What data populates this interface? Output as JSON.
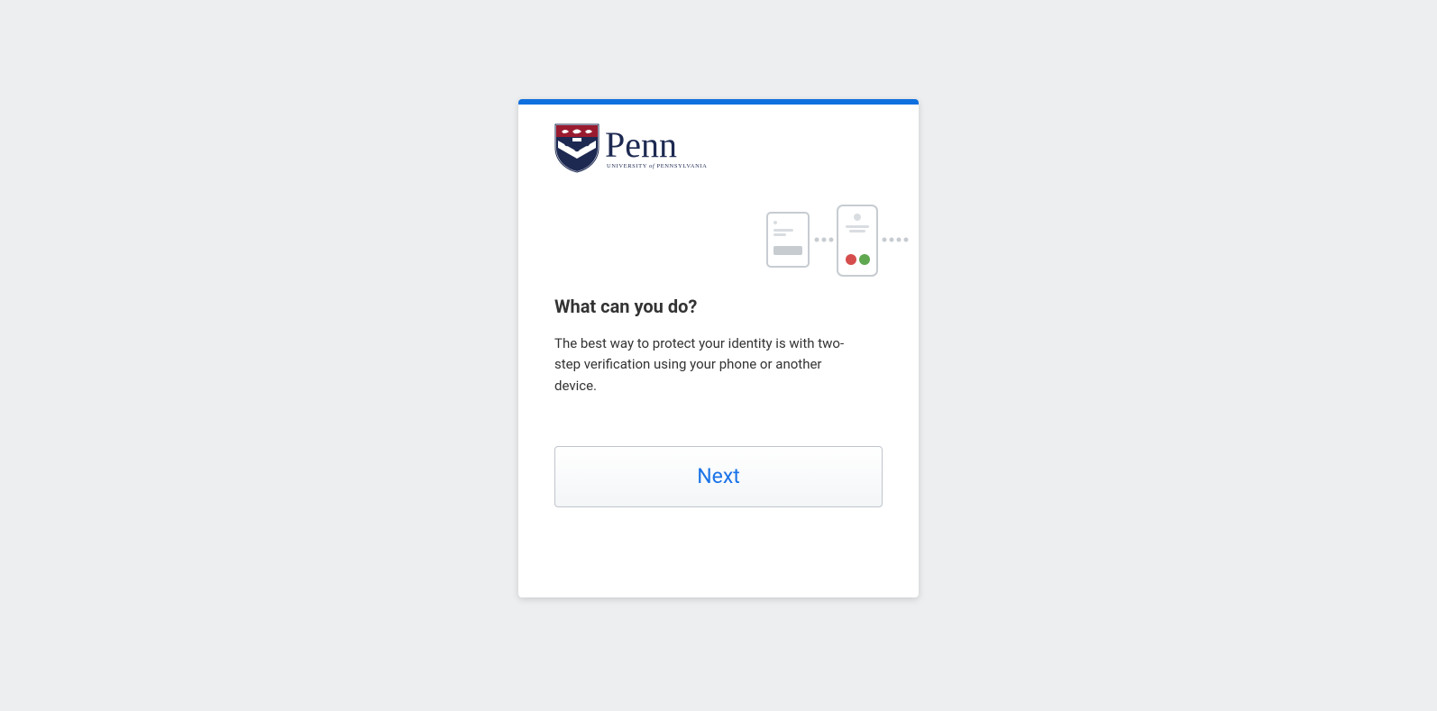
{
  "logo": {
    "wordmark": "Penn",
    "subtext": "UNIVERSITY of PENNSYLVANIA"
  },
  "heading": "What can you do?",
  "body": "The best way to protect your identity is with two-step verification using your phone or another device.",
  "button": {
    "next_label": "Next"
  }
}
